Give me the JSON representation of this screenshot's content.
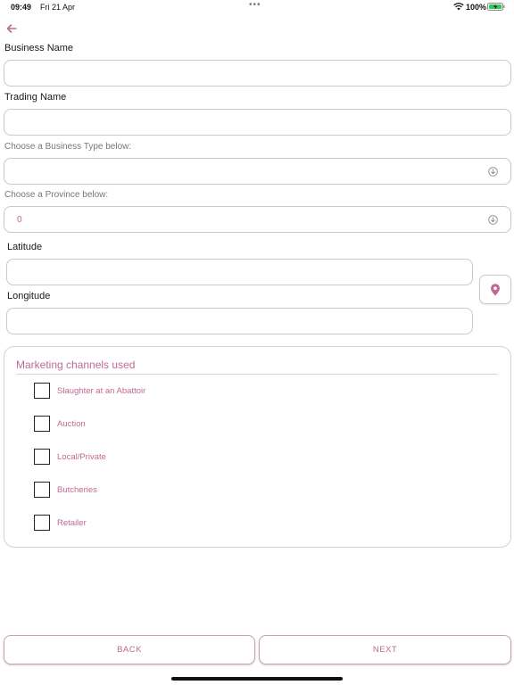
{
  "status_bar": {
    "time": "09:49",
    "date": "Fri 21 Apr",
    "battery": "100%"
  },
  "colors": {
    "accent": "#c06a93",
    "border": "#c9c9c9"
  },
  "form": {
    "business_name": {
      "label": "Business Name",
      "value": ""
    },
    "trading_name": {
      "label": "Trading Name",
      "value": ""
    },
    "business_type": {
      "label": "Choose a Business Type below:",
      "value": ""
    },
    "province": {
      "label": "Choose a Province below:",
      "value": "0"
    },
    "latitude": {
      "label": "Latitude",
      "value": ""
    },
    "longitude": {
      "label": "Longitude",
      "value": ""
    }
  },
  "marketing": {
    "title": "Marketing channels used",
    "items": [
      {
        "label": "Slaughter at an Abattoir",
        "checked": false
      },
      {
        "label": "Auction",
        "checked": false
      },
      {
        "label": "Local/Private",
        "checked": false
      },
      {
        "label": "Butcheries",
        "checked": false
      },
      {
        "label": "Retailer",
        "checked": false
      }
    ]
  },
  "footer": {
    "back_label": "BACK",
    "next_label": "NEXT"
  },
  "icons": {
    "back": "arrow-left-icon",
    "location": "map-pin-icon",
    "select": "chevron-down-circle-icon"
  }
}
